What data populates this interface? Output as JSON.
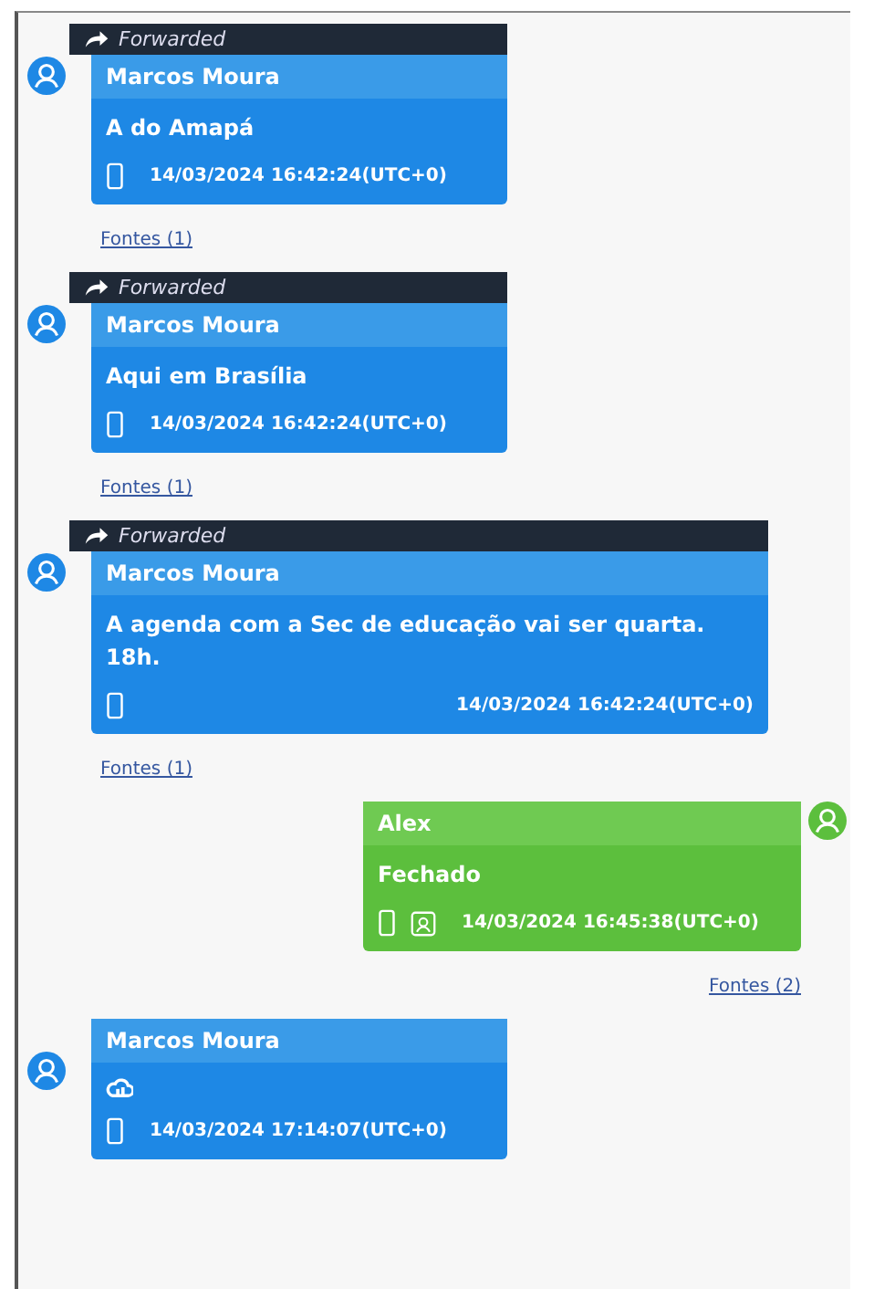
{
  "messages": [
    {
      "kind": "incoming",
      "forwarded_label": "Forwarded",
      "sender": "Marcos Moura",
      "text": "A do Amapá",
      "footer_icons": [
        {
          "kind": "phone"
        }
      ],
      "time": "14/03/2024 16:42:24(UTC+0)",
      "sources": "Fontes (1)"
    },
    {
      "kind": "incoming",
      "forwarded_label": "Forwarded",
      "sender": "Marcos Moura",
      "text": "Aqui em Brasília",
      "footer_icons": [
        {
          "kind": "phone"
        }
      ],
      "time": "14/03/2024 16:42:24(UTC+0)",
      "sources": "Fontes (1)"
    },
    {
      "kind": "incoming",
      "forwarded_label": "Forwarded",
      "sender": "Marcos Moura",
      "text": "A agenda com a Sec de educação vai ser quarta. 18h.",
      "footer_icons": [
        {
          "kind": "phone"
        }
      ],
      "time": "14/03/2024 16:42:24(UTC+0)",
      "sources": "Fontes (1)"
    },
    {
      "kind": "outgoing",
      "sender": "Alex",
      "text": "Fechado",
      "footer_icons": [
        {
          "kind": "phone"
        },
        {
          "kind": "contact"
        }
      ],
      "time": "14/03/2024 16:45:38(UTC+0)",
      "sources": "Fontes (2)"
    },
    {
      "kind": "incoming",
      "sender": "Marcos Moura",
      "body_icon": {
        "kind": "cloud"
      },
      "footer_icons": [
        {
          "kind": "phone"
        }
      ],
      "time": "14/03/2024 17:14:07(UTC+0)"
    }
  ]
}
